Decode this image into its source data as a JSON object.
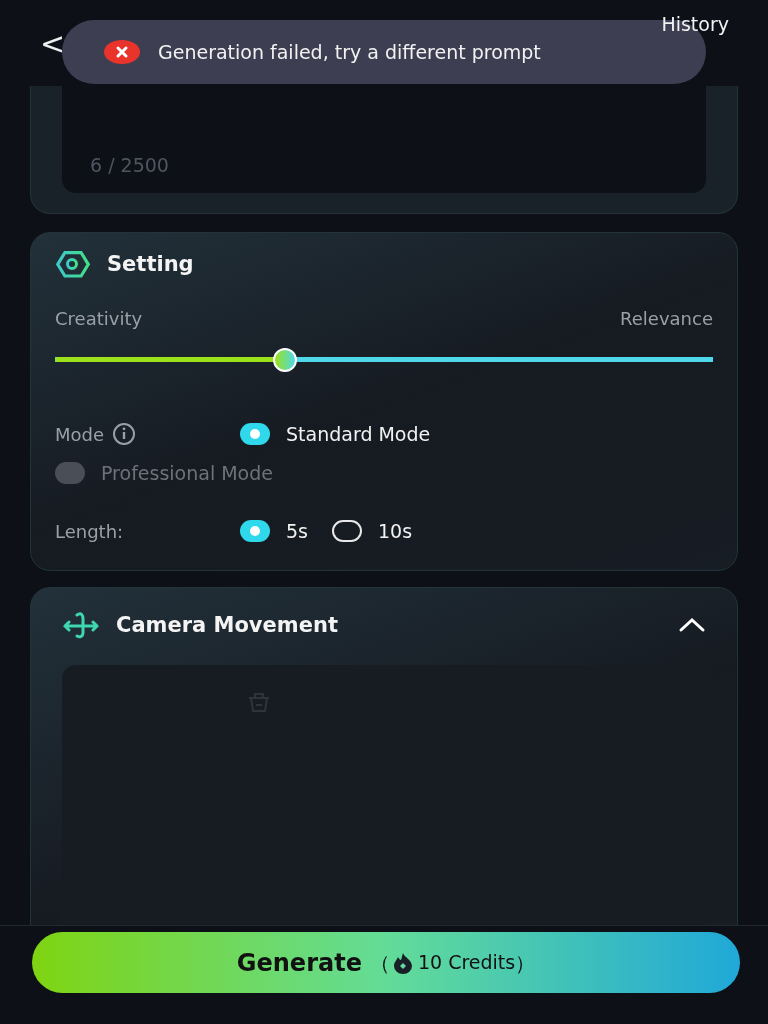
{
  "header": {
    "back": "<",
    "history": "History"
  },
  "toast": {
    "message": "Generation failed, try a different prompt",
    "kind": "error"
  },
  "prompt": {
    "counter": "6 / 2500"
  },
  "setting": {
    "title": "Setting",
    "slider": {
      "left_label": "Creativity",
      "right_label": "Relevance",
      "level": 0.35
    },
    "mode": {
      "label": "Mode",
      "options": [
        {
          "label": "Standard Mode",
          "selected": true,
          "disabled": false
        },
        {
          "label": "Professional Mode",
          "selected": false,
          "disabled": true
        }
      ]
    },
    "length": {
      "label": "Length:",
      "options": [
        {
          "label": "5s",
          "selected": true,
          "disabled": false
        },
        {
          "label": "10s",
          "selected": false,
          "disabled": false
        }
      ]
    }
  },
  "camera": {
    "title": "Camera Movement",
    "expanded": true
  },
  "generate": {
    "label": "Generate",
    "credits": "10 Credits",
    "open": "（",
    "close": "）"
  }
}
